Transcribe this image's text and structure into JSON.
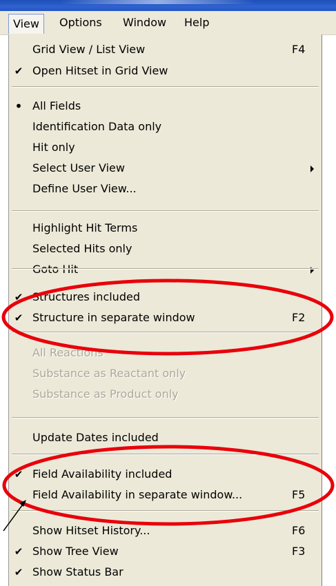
{
  "menubar": {
    "items": [
      {
        "label": "View"
      },
      {
        "label": "Options"
      },
      {
        "label": "Window"
      },
      {
        "label": "Help"
      }
    ]
  },
  "view_menu": {
    "items": [
      {
        "label": "Grid View / List View",
        "shortcut": "F4",
        "checked": false
      },
      {
        "label": "Open Hitset in Grid View",
        "shortcut": "",
        "checked": true
      },
      {
        "label": "All Fields",
        "shortcut": "",
        "bullet": true
      },
      {
        "label": "Identification Data only",
        "shortcut": ""
      },
      {
        "label": "Hit only",
        "shortcut": ""
      },
      {
        "label": "Select User View",
        "shortcut": "",
        "submenu": true
      },
      {
        "label": "Define User View...",
        "shortcut": ""
      },
      {
        "label": "Highlight Hit Terms",
        "shortcut": ""
      },
      {
        "label": "Selected Hits only",
        "shortcut": ""
      },
      {
        "label": "Goto Hit",
        "shortcut": "",
        "submenu": true
      },
      {
        "label": "Structures included",
        "shortcut": "",
        "checked": true
      },
      {
        "label": "Structure in separate window",
        "shortcut": "F2",
        "checked": true
      },
      {
        "label": "All Reactions",
        "shortcut": "",
        "disabled": true
      },
      {
        "label": "Substance as Reactant only",
        "shortcut": "",
        "disabled": true
      },
      {
        "label": "Substance as Product only",
        "shortcut": "",
        "disabled": true
      },
      {
        "label": "Update Dates included",
        "shortcut": ""
      },
      {
        "label": "Field Availability included",
        "shortcut": "",
        "checked": true
      },
      {
        "label": "Field Availability in separate window...",
        "shortcut": "F5",
        "checked": false
      },
      {
        "label": "Show Hitset History...",
        "shortcut": "F6"
      },
      {
        "label": "Show Tree View",
        "shortcut": "F3",
        "checked": true
      },
      {
        "label": "Show Status Bar",
        "shortcut": "",
        "checked": true
      }
    ]
  },
  "annotation_color": "#e8000b"
}
